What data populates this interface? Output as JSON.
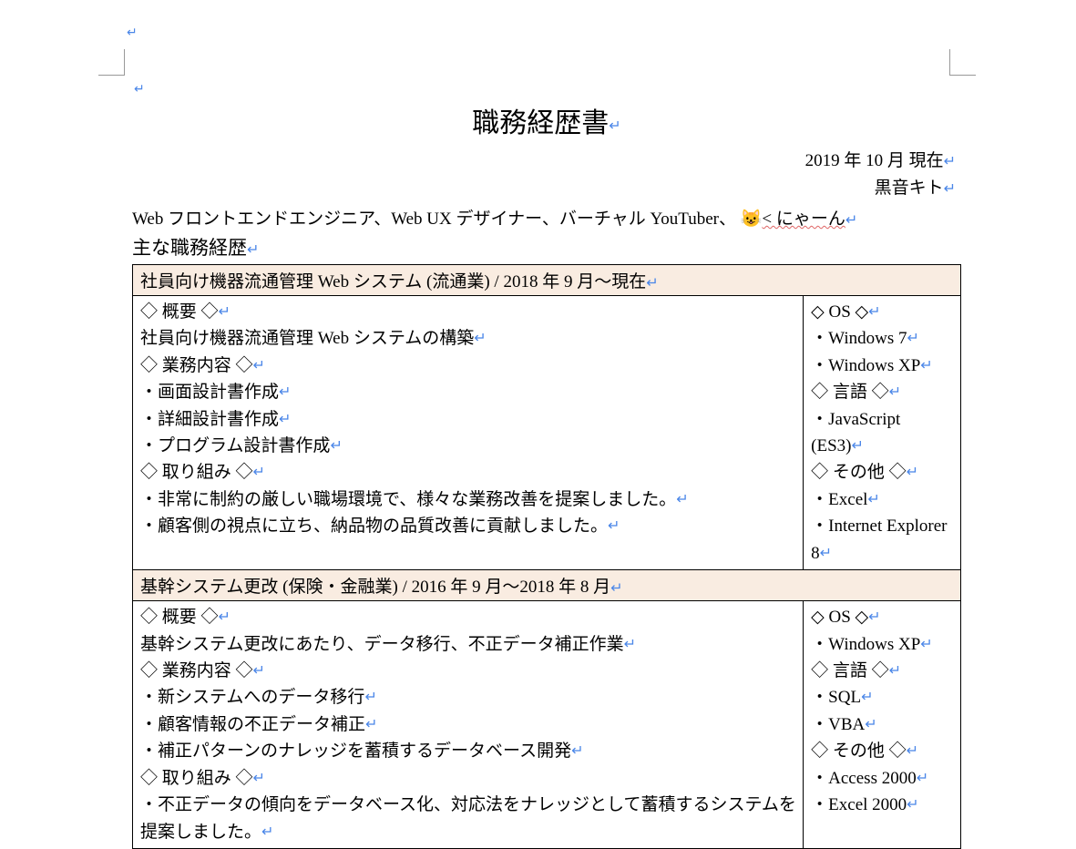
{
  "title": "職務経歴書",
  "meta": {
    "date": "2019 年 10 月 現在",
    "name": "黒音キト"
  },
  "intro_prefix": "Web フロントエンドエンジニア、Web UX デザイナー、バーチャル YouTuber、",
  "intro_suffix_squiggle": "< にゃーん",
  "section_heading": "主な職務経歴",
  "marks": {
    "p": "↵",
    "cat": "😺"
  },
  "projects": [
    {
      "header": "社員向け機器流通管理 Web システム (流通業) / 2018 年 9 月〜現在",
      "left": {
        "overview_label": "◇ 概要 ◇",
        "overview_text": "社員向け機器流通管理 Web システムの構築",
        "work_label": "◇ 業務内容 ◇",
        "work_items": [
          "・画面設計書作成",
          "・詳細設計書作成",
          "・プログラム設計書作成"
        ],
        "effort_label": "◇ 取り組み ◇",
        "effort_items": [
          "・非常に制約の厳しい職場環境で、様々な業務改善を提案しました。",
          "・顧客側の視点に立ち、納品物の品質改善に貢献しました。"
        ]
      },
      "right": {
        "os_label": "◇ OS ◇",
        "os_items": [
          "・Windows 7",
          "・Windows XP"
        ],
        "lang_label": "◇ 言語 ◇",
        "lang_items": [
          "・JavaScript (ES3)"
        ],
        "other_label": "◇ その他 ◇",
        "other_items": [
          "・Excel",
          "・Internet Explorer 8"
        ]
      }
    },
    {
      "header": "基幹システム更改 (保険・金融業) / 2016 年 9 月〜2018 年 8 月",
      "left": {
        "overview_label": "◇ 概要 ◇",
        "overview_text": "基幹システム更改にあたり、データ移行、不正データ補正作業",
        "work_label": "◇ 業務内容 ◇",
        "work_items": [
          "・新システムへのデータ移行",
          "・顧客情報の不正データ補正",
          "・補正パターンのナレッジを蓄積するデータベース開発"
        ],
        "effort_label": "◇ 取り組み ◇",
        "effort_items": [
          "・不正データの傾向をデータベース化、対応法をナレッジとして蓄積するシステムを提案しました。"
        ]
      },
      "right": {
        "os_label": "◇ OS ◇",
        "os_items": [
          "・Windows XP"
        ],
        "lang_label": "◇ 言語 ◇",
        "lang_items": [
          "・SQL",
          "・VBA"
        ],
        "other_label": "◇ その他 ◇",
        "other_items": [
          "・Access 2000",
          "・Excel 2000"
        ]
      }
    }
  ]
}
